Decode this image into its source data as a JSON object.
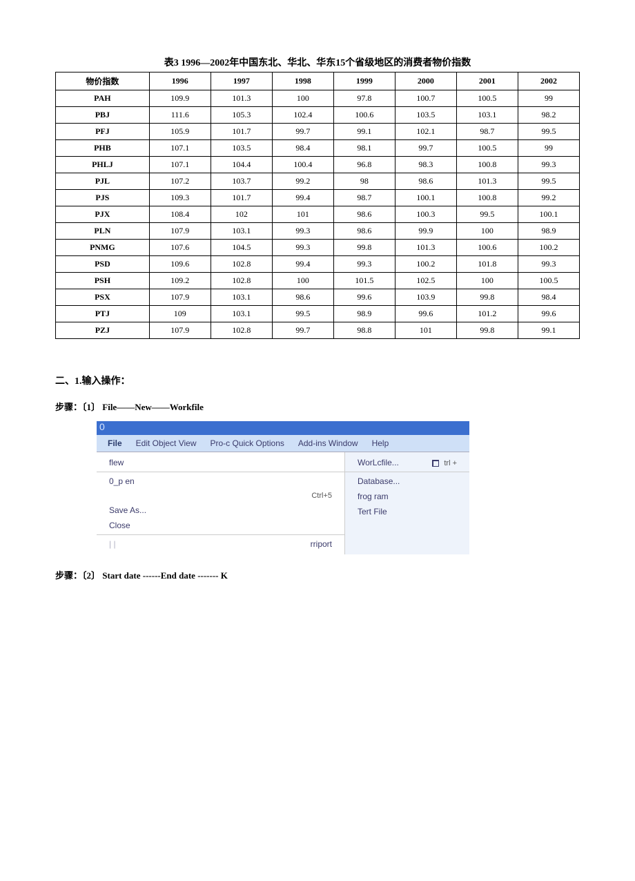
{
  "chart_data": {
    "type": "table",
    "title": "表3 1996—2002年中国东北、华北、华东15个省级地区的消费者物价指数",
    "columns": [
      "物价指数",
      "1996",
      "1997",
      "1998",
      "1999",
      "2000",
      "2001",
      "2002"
    ],
    "rows": [
      [
        "PAH",
        109.9,
        101.3,
        100,
        97.8,
        100.7,
        100.5,
        99
      ],
      [
        "PBJ",
        111.6,
        105.3,
        102.4,
        100.6,
        103.5,
        103.1,
        98.2
      ],
      [
        "PFJ",
        105.9,
        101.7,
        99.7,
        99.1,
        102.1,
        98.7,
        99.5
      ],
      [
        "PHB",
        107.1,
        103.5,
        98.4,
        98.1,
        99.7,
        100.5,
        99
      ],
      [
        "PHLJ",
        107.1,
        104.4,
        100.4,
        96.8,
        98.3,
        100.8,
        99.3
      ],
      [
        "PJL",
        107.2,
        103.7,
        99.2,
        98,
        98.6,
        101.3,
        99.5
      ],
      [
        "PJS",
        109.3,
        101.7,
        99.4,
        98.7,
        100.1,
        100.8,
        99.2
      ],
      [
        "PJX",
        108.4,
        102,
        101,
        98.6,
        100.3,
        99.5,
        100.1
      ],
      [
        "PLN",
        107.9,
        103.1,
        99.3,
        98.6,
        99.9,
        100,
        98.9
      ],
      [
        "PNMG",
        107.6,
        104.5,
        99.3,
        99.8,
        101.3,
        100.6,
        100.2
      ],
      [
        "PSD",
        109.6,
        102.8,
        99.4,
        99.3,
        100.2,
        101.8,
        99.3
      ],
      [
        "PSH",
        109.2,
        102.8,
        100,
        101.5,
        102.5,
        100,
        100.5
      ],
      [
        "PSX",
        107.9,
        103.1,
        98.6,
        99.6,
        103.9,
        99.8,
        98.4
      ],
      [
        "PTJ",
        109,
        103.1,
        99.5,
        98.9,
        99.6,
        101.2,
        99.6
      ],
      [
        "PZJ",
        107.9,
        102.8,
        99.7,
        98.8,
        101,
        99.8,
        99.1
      ]
    ]
  },
  "section2_heading": "二、1.输入操作：",
  "step1_prefix": "步骤：〔1〕",
  "step1_text": "File——New——Workfile",
  "step2_prefix": "步骤：〔2〕",
  "step2_text": "Start date ------End date ------- K",
  "menu": {
    "title_char": "0",
    "menubar": [
      "File",
      "Edit Object View",
      "Pro-c Quick Options",
      "Add-ins Window",
      "Help"
    ],
    "left_items": [
      {
        "label": "flew",
        "shortcut": ""
      },
      {
        "label": "0_p en",
        "shortcut": ""
      },
      {
        "label": "",
        "shortcut": "Ctrl+5"
      },
      {
        "label": "Save As...",
        "shortcut": ""
      },
      {
        "label": "Close",
        "shortcut": ""
      },
      {
        "label": "rriport",
        "shortcut": ""
      }
    ],
    "right_items": [
      {
        "label": "WorLcfile...",
        "shortcut": "trl +",
        "icon": true
      },
      {
        "label": "Database...",
        "shortcut": ""
      },
      {
        "label": "frog ram",
        "shortcut": ""
      },
      {
        "label": "Tert File",
        "shortcut": ""
      }
    ]
  }
}
